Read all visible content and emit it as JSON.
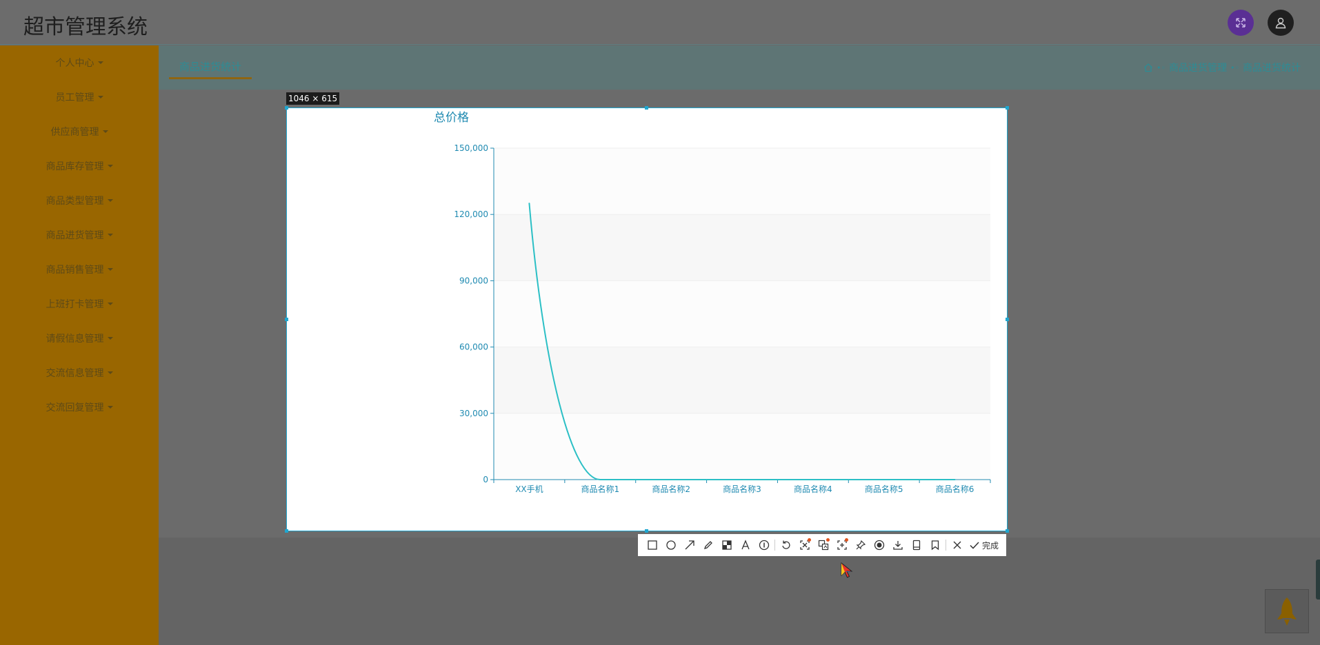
{
  "app": {
    "title": "超市管理系统"
  },
  "header": {
    "fullscreen_icon": "fullscreen-icon",
    "user_icon": "user-icon"
  },
  "sidebar": {
    "items": [
      {
        "label": "个人中心"
      },
      {
        "label": "员工管理"
      },
      {
        "label": "供应商管理"
      },
      {
        "label": "商品库存管理"
      },
      {
        "label": "商品类型管理"
      },
      {
        "label": "商品进货管理"
      },
      {
        "label": "商品销售管理"
      },
      {
        "label": "上班打卡管理"
      },
      {
        "label": "请假信息管理"
      },
      {
        "label": "交流信息管理"
      },
      {
        "label": "交流回复管理"
      }
    ]
  },
  "tabs": {
    "active": "商品进货统计"
  },
  "breadcrumb": {
    "items": [
      "商品进货管理",
      "商品进货统计"
    ]
  },
  "capture": {
    "size_label": "1046 × 615"
  },
  "toolbar": {
    "tools": [
      "rectangle-icon",
      "ellipse-icon",
      "arrow-icon",
      "pen-icon",
      "mosaic-icon",
      "text-icon",
      "number-icon",
      "undo-icon",
      "ocr-icon",
      "translate-icon",
      "scroll-capture-icon",
      "pin-icon",
      "record-icon",
      "download-icon",
      "save-icon",
      "bookmark-icon",
      "close-icon"
    ],
    "done_label": "完成"
  },
  "colors": {
    "line": "#2bbfc5",
    "axis": "#1f8ab1",
    "sidebar": "#996600",
    "capture_border": "#1fa7d0"
  },
  "chart_data": {
    "type": "line",
    "title": "总价格",
    "xlabel": "",
    "ylabel": "",
    "categories": [
      "XX手机",
      "商品名称1",
      "商品名称2",
      "商品名称3",
      "商品名称4",
      "商品名称5",
      "商品名称6"
    ],
    "values": [
      125000,
      0,
      0,
      0,
      0,
      0,
      0
    ],
    "ylim": [
      0,
      150000
    ],
    "yticks": [
      0,
      30000,
      60000,
      90000,
      120000,
      150000
    ],
    "ytick_labels": [
      "0",
      "30,000",
      "60,000",
      "90,000",
      "120,000",
      "150,000"
    ],
    "smooth": true,
    "grid": true
  }
}
